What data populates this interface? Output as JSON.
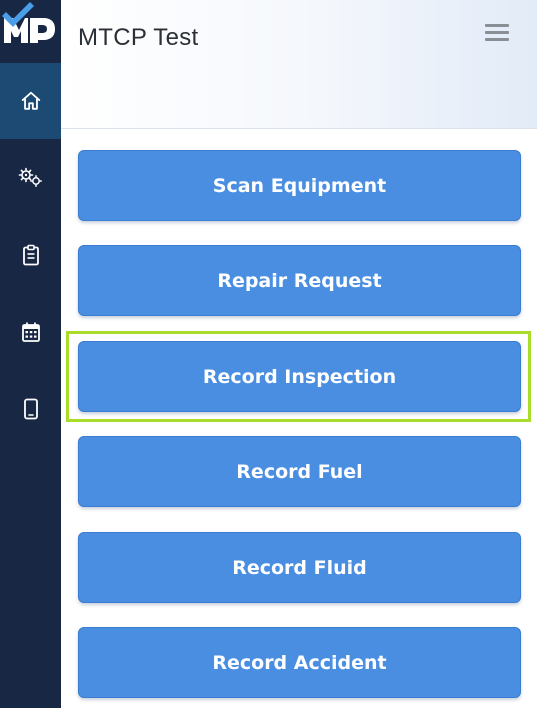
{
  "header": {
    "title": "MTCP Test",
    "menu_icon": "hamburger-menu-icon"
  },
  "sidebar": {
    "logo": {
      "text": "MP"
    },
    "items": [
      {
        "icon": "home-icon",
        "active": true
      },
      {
        "icon": "gears-icon",
        "active": false
      },
      {
        "icon": "clipboard-icon",
        "active": false
      },
      {
        "icon": "calendar-icon",
        "active": false
      },
      {
        "icon": "mobile-device-icon",
        "active": false
      }
    ]
  },
  "actions": [
    {
      "label": "Scan Equipment"
    },
    {
      "label": "Repair Request"
    },
    {
      "label": "Record Inspection",
      "highlighted": true
    },
    {
      "label": "Record Fuel"
    },
    {
      "label": "Record Fluid"
    },
    {
      "label": "Record Accident"
    }
  ],
  "colors": {
    "sidebar": "#172744",
    "sidebar_active": "#1d4a73",
    "button": "#4a8ee2",
    "highlight": "#a9dd2a"
  }
}
